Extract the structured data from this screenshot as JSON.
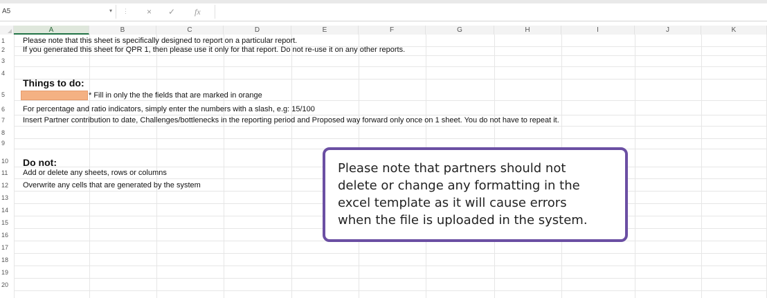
{
  "formula_bar": {
    "name_box": "A5",
    "cancel_icon": "×",
    "enter_icon": "✓",
    "fx_label": "fx"
  },
  "columns": [
    "A",
    "B",
    "C",
    "D",
    "E",
    "F",
    "G",
    "H",
    "I",
    "J",
    "K"
  ],
  "rows": [
    "1",
    "2",
    "3",
    "4",
    "5",
    "6",
    "7",
    "8",
    "9",
    "10",
    "11",
    "12",
    "13",
    "14",
    "15",
    "16",
    "17",
    "18",
    "19",
    "20"
  ],
  "cells": {
    "r1": "Please note that this sheet is specifically designed to report on a particular report.",
    "r2": "If you generated this sheet for QPR 1, then please use it only for that report. Do not re-use it on any other reports.",
    "r4": "Things to do:",
    "r5": "* Fill in only the the fields that are marked in orange",
    "r6": "For percentage and ratio indicators, simply enter the numbers with a slash, e.g: 15/100",
    "r7": "Insert Partner contribution to date, Challenges/bottlenecks in the reporting period and Proposed way forward only once on 1 sheet. You do not have to repeat it.",
    "r10": "Do not:",
    "r11": "Add or delete any sheets, rows or columns",
    "r12": "Overwrite any cells that are generated by the system"
  },
  "colors": {
    "orange_fill": "#f4b183",
    "callout_border": "#6b4fa3",
    "selection_green": "#217346"
  },
  "callout": {
    "lines": [
      "Please note that partners should not",
      "delete or change any formatting in the",
      "excel template as it will cause errors",
      "when the file is uploaded in the system."
    ]
  }
}
